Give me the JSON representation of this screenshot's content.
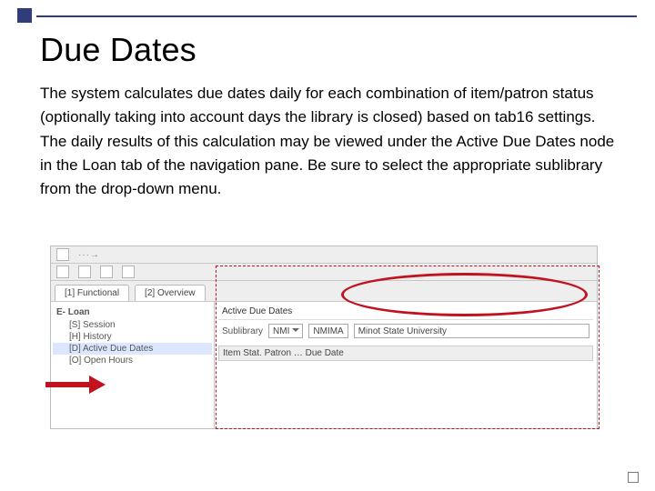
{
  "slide": {
    "title": "Due Dates",
    "body": "The system calculates due dates daily for each combination of item/patron status (optionally taking into account days the library is closed) based on tab16 settings.  The daily results of this calculation may be viewed under the Active Due Dates node in the Loan tab of the navigation pane.  Be sure to select the appropriate sublibrary from the drop-down menu."
  },
  "app": {
    "tabs": {
      "functional": "[1] Functional",
      "overview": "[2] Overview"
    },
    "nav": {
      "root": "E- Loan",
      "items": [
        "[S] Session",
        "[H] History",
        "[D] Active Due Dates",
        "[O] Open Hours"
      ],
      "selected_index": 2
    },
    "pane": {
      "title": "Active Due Dates",
      "sublibrary_label": "Sublibrary",
      "sublibrary_value": "NMI",
      "org_code": "NMIMA",
      "org_name": "Minot State University",
      "list_header": "Item Stat. Patron … Due Date"
    }
  },
  "icons": {
    "toolbar_more": "···→"
  }
}
